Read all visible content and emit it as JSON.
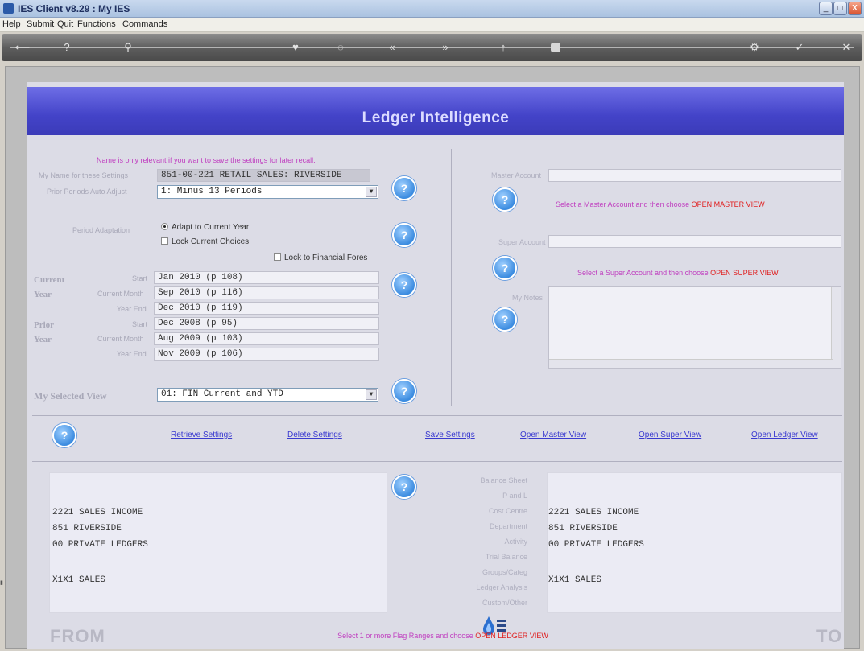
{
  "window": {
    "title": "IES Client v8.29 : My IES",
    "buttons": [
      "_",
      "□",
      "X"
    ]
  },
  "menu": [
    "Help",
    "Submit",
    "Quit",
    "Functions",
    "Commands"
  ],
  "toolbar": {
    "icons": [
      "back-arrow-icon",
      "help-icon",
      "search-icon",
      "heart-icon",
      "refresh-icon",
      "rewind-icon",
      "forward-icon",
      "up-icon",
      "stop-icon",
      "settings-icon",
      "check-icon",
      "close-icon"
    ],
    "glyphs": [
      "⟵",
      "?",
      "⚲",
      "♥",
      "◌",
      "«",
      "»",
      "↑",
      "■",
      "⚙",
      "✓",
      "✕"
    ]
  },
  "banner": {
    "title": "Ledger Intelligence"
  },
  "settings": {
    "hint": "Name is only relevant if you want to save the settings for later recall.",
    "name_label": "My Name for these Settings",
    "name_value": "851-00-221 RETAIL SALES: RIVERSIDE",
    "prior_label": "Prior Periods Auto Adjust",
    "prior_value": "1: Minus 13 Periods",
    "adaptation_label": "Period Adaptation",
    "adapt_option": "Adapt to Current Year",
    "lock_option": "Lock Current Choices",
    "lock_financial": "Lock to Financial Fores"
  },
  "periods": {
    "current_label_1": "Current",
    "current_label_2": "Year",
    "prior_label_1": "Prior",
    "prior_label_2": "Year",
    "start_label": "Start",
    "month_label": "Current Month",
    "end_label": "Year End",
    "current_start": "Jan 2010 (p 108)",
    "current_month": "Sep 2010 (p 116)",
    "current_end": "Dec 2010 (p 119)",
    "prior_start": "Dec 2008 (p 95)",
    "prior_month": "Aug 2009 (p 103)",
    "prior_end": "Nov 2009 (p 106)"
  },
  "view": {
    "label": "My Selected View",
    "value": "01: FIN Current and YTD"
  },
  "right": {
    "master_label": "Master Account",
    "master_hint_a": "Select a Master Account and then choose",
    "master_hint_b": "OPEN MASTER VIEW",
    "super_label": "Super Account",
    "super_hint_a": "Select a Super Account and then choose",
    "super_hint_b": "OPEN SUPER VIEW",
    "notes_label": "My Notes"
  },
  "actions": {
    "retrieve": "Retrieve Settings",
    "delete": "Delete Settings",
    "save": "Save Settings",
    "open_master": "Open Master View",
    "open_super": "Open Super View",
    "open_ledger": "Open Ledger View"
  },
  "flags": [
    "Balance Sheet",
    "P and L",
    "Cost Centre",
    "Department",
    "Activity",
    "Trial Balance",
    "Groups/Categ",
    "Ledger Analysis",
    "Custom/Other"
  ],
  "from": {
    "label": "FROM",
    "lines": [
      "2221 SALES INCOME",
      "851 RIVERSIDE",
      "00 PRIVATE LEDGERS",
      "X1X1 SALES"
    ]
  },
  "to": {
    "label": "TO",
    "lines": [
      "2221 SALES INCOME",
      "851 RIVERSIDE",
      "00 PRIVATE LEDGERS",
      "X1X1 SALES"
    ]
  },
  "footer": {
    "hint_a": "Select 1 or more Flag Ranges and choose",
    "hint_b": "OPEN LEDGER VIEW"
  }
}
